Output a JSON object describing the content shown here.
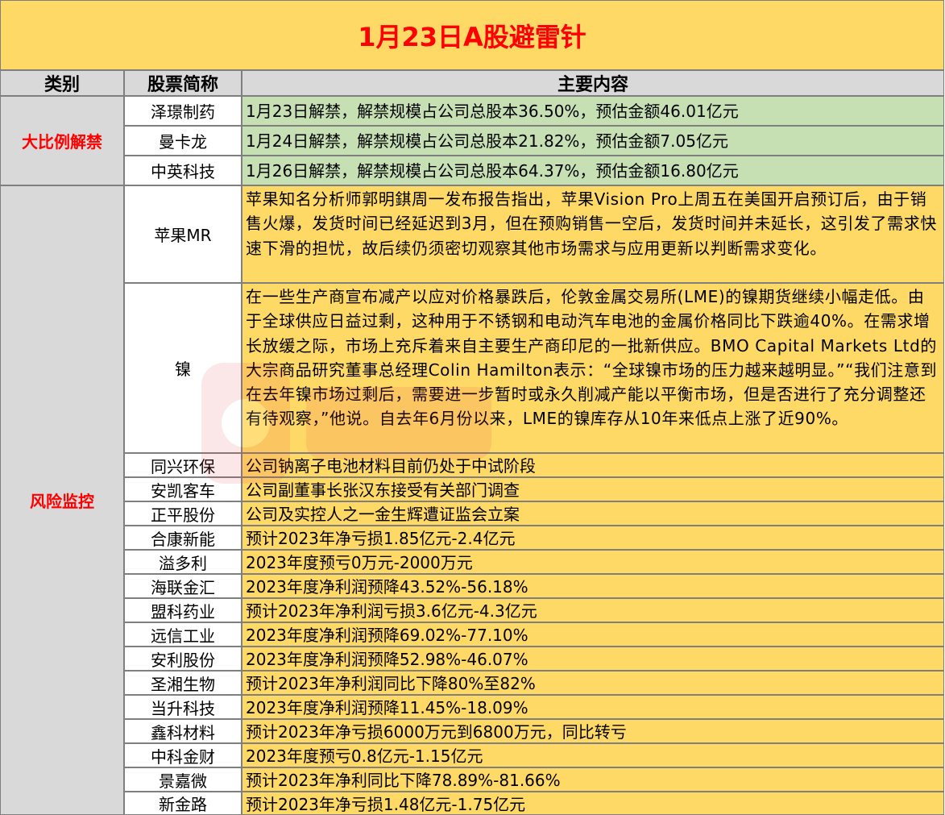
{
  "title": "1月23日A股避雷针",
  "headers": {
    "category": "类别",
    "stock": "股票简称",
    "content": "主要内容"
  },
  "categories": {
    "unlock": "大比例解禁",
    "risk": "风险监控"
  },
  "rows": [
    {
      "name": "泽璟制药",
      "content": "1月23日解禁，解禁规模占公司总股本36.50%，预估金额46.01亿元"
    },
    {
      "name": "曼卡龙",
      "content": "1月24日解禁，解禁规模占公司总股本21.82%，预估金额7.05亿元"
    },
    {
      "name": "中英科技",
      "content": "1月26日解禁，解禁规模占公司总股本64.37%，预估金额16.80亿元"
    },
    {
      "name": "苹果MR",
      "content": "苹果知名分析师郭明錤周一发布报告指出，苹果Vision Pro上周五在美国开启预订后，由于销售火爆，发货时间已经延迟到3月，但在预购销售一空后，发货时间并未延长，这引发了需求快速下滑的担忧，故后续仍须密切观察其他市场需求与应用更新以判断需求变化。"
    },
    {
      "name": "镍",
      "content": "在一些生产商宣布减产以应对价格暴跌后，伦敦金属交易所(LME)的镍期货继续小幅走低。由于全球供应日益过剩，这种用于不锈钢和电动汽车电池的金属价格同比下跌逾40%。在需求增长放缓之际，市场上充斥着来自主要生产商印尼的一批新供应。BMO Capital Markets Ltd的大宗商品研究董事总经理Colin Hamilton表示：“全球镍市场的压力越来越明显。”“我们注意到在去年镍市场过剩后，需要进一步暂时或永久削减产能以平衡市场，但是否进行了充分调整还有待观察，”他说。自去年6月份以来，LME的镍库存从10年来低点上涨了近90%。"
    },
    {
      "name": "同兴环保",
      "content": "公司钠离子电池材料目前仍处于中试阶段"
    },
    {
      "name": "安凯客车",
      "content": "公司副董事长张汉东接受有关部门调查"
    },
    {
      "name": "正平股份",
      "content": "公司及实控人之一金生辉遭证监会立案"
    },
    {
      "name": "合康新能",
      "content": "预计2023年净亏损1.85亿元-2.4亿元"
    },
    {
      "name": "溢多利",
      "content": "2023年度预亏0万元-2000万元"
    },
    {
      "name": "海联金汇",
      "content": "2023年度净利润预降43.52%-56.18%"
    },
    {
      "name": "盟科药业",
      "content": "预计2023年净利润亏损3.6亿元-4.3亿元"
    },
    {
      "name": "远信工业",
      "content": "2023年度净利润预降69.02%-77.10%"
    },
    {
      "name": "安利股份",
      "content": "2023年度净利润预降52.98%-46.07%"
    },
    {
      "name": "圣湘生物",
      "content": "预计2023年净利润同比下降80%至82%"
    },
    {
      "name": "当升科技",
      "content": "2023年度净利润预降11.45%-18.09%"
    },
    {
      "name": "鑫科材料",
      "content": "预计2023年净亏损6000万元到6800万元，同比转亏"
    },
    {
      "name": "中科金财",
      "content": "2023年度预亏0.8亿元-1.15亿元"
    },
    {
      "name": "景嘉微",
      "content": "预计2023年净利同比下降78.89%-81.66%"
    },
    {
      "name": "新金路",
      "content": "预计2023年净亏损1.48亿元-1.75亿元"
    }
  ]
}
